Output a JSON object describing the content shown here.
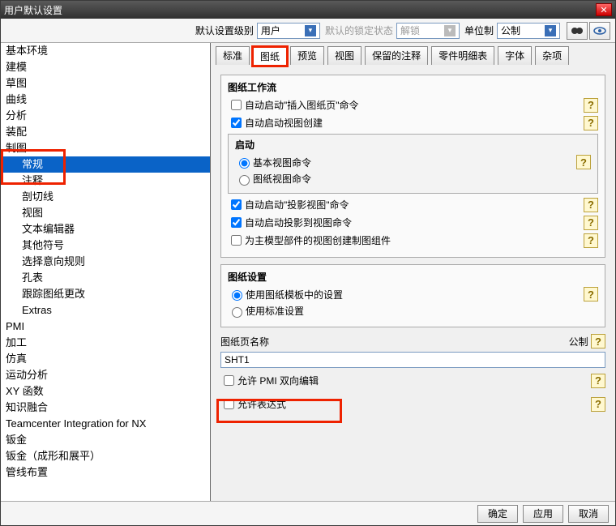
{
  "window": {
    "title": "用户默认设置"
  },
  "toolbar": {
    "level_label": "默认设置级别",
    "level_value": "用户",
    "lock_label": "默认的锁定状态",
    "lock_value": "解锁",
    "unit_label": "单位制",
    "unit_value": "公制"
  },
  "nav": {
    "items": [
      {
        "label": "基本环境",
        "indent": false
      },
      {
        "label": "建模",
        "indent": false
      },
      {
        "label": "草图",
        "indent": false
      },
      {
        "label": "曲线",
        "indent": false
      },
      {
        "label": "分析",
        "indent": false
      },
      {
        "label": "装配",
        "indent": false
      },
      {
        "label": "制图",
        "indent": false
      },
      {
        "label": "常规",
        "indent": true,
        "selected": true
      },
      {
        "label": "注释",
        "indent": true
      },
      {
        "label": "剖切线",
        "indent": true
      },
      {
        "label": "视图",
        "indent": true
      },
      {
        "label": "文本编辑器",
        "indent": true
      },
      {
        "label": "其他符号",
        "indent": true
      },
      {
        "label": "选择意向规则",
        "indent": true
      },
      {
        "label": "孔表",
        "indent": true
      },
      {
        "label": "跟踪图纸更改",
        "indent": true
      },
      {
        "label": "Extras",
        "indent": true
      },
      {
        "label": "PMI",
        "indent": false
      },
      {
        "label": "加工",
        "indent": false
      },
      {
        "label": "仿真",
        "indent": false
      },
      {
        "label": "运动分析",
        "indent": false
      },
      {
        "label": "XY 函数",
        "indent": false
      },
      {
        "label": "知识融合",
        "indent": false
      },
      {
        "label": "Teamcenter Integration for NX",
        "indent": false
      },
      {
        "label": "钣金",
        "indent": false
      },
      {
        "label": "钣金（成形和展平）",
        "indent": false
      },
      {
        "label": "管线布置",
        "indent": false
      }
    ]
  },
  "tabs": [
    "标准",
    "图纸",
    "预览",
    "视图",
    "保留的注释",
    "零件明细表",
    "字体",
    "杂项"
  ],
  "active_tab": 1,
  "content": {
    "group1": {
      "legend": "图纸工作流",
      "auto_insert": "自动启动\"插入图纸页\"命令",
      "auto_viewcreate": "自动启动视图创建",
      "startup_legend": "启动",
      "startup_basic": "基本视图命令",
      "startup_drawing": "图纸视图命令",
      "auto_project": "自动启动\"投影视图\"命令",
      "auto_projto": "自动启动投影到视图命令",
      "create_comp": "为主模型部件的视图创建制图组件"
    },
    "group2": {
      "legend": "图纸设置",
      "use_template": "使用图纸模板中的设置",
      "use_standard": "使用标准设置"
    },
    "sheetname_label": "图纸页名称",
    "sheetname_unit": "公制",
    "sheetname_value": "SHT1",
    "allow_pmi": "允许 PMI 双向编辑",
    "allow_expr": "允许表达式"
  },
  "footer": {
    "ok": "确定",
    "apply": "应用",
    "cancel": "取消"
  }
}
